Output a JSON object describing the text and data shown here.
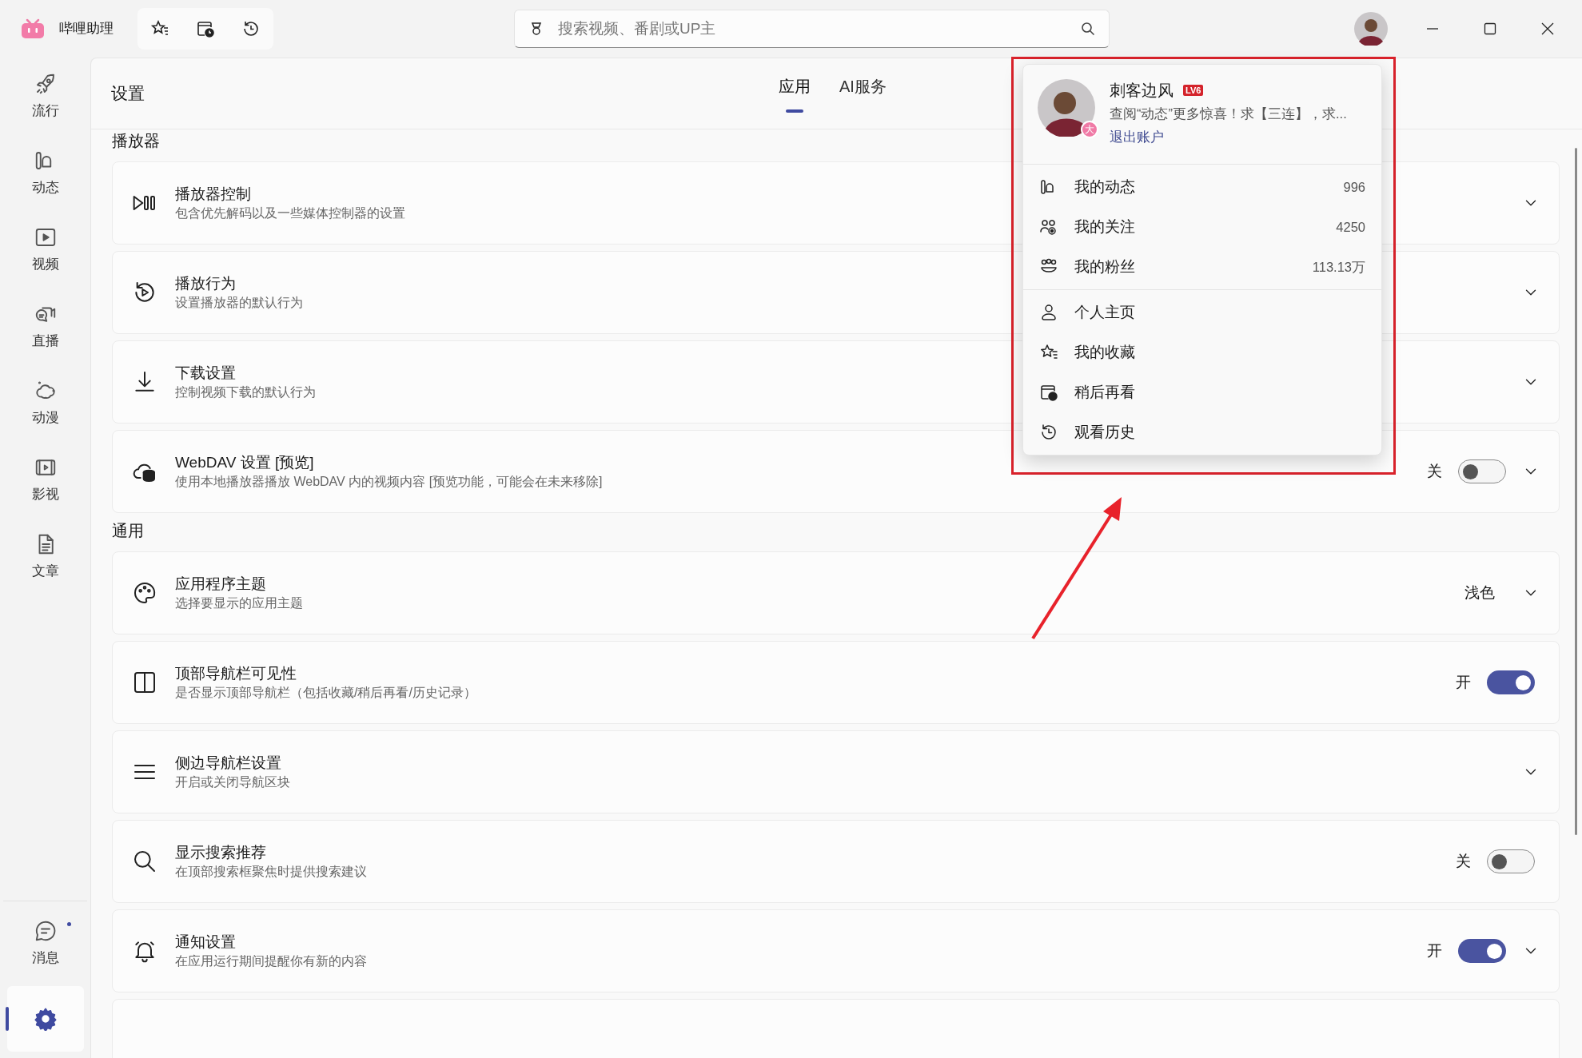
{
  "app": {
    "title": "哔哩助理"
  },
  "search": {
    "placeholder": "搜索视频、番剧或UP主"
  },
  "sidebar": {
    "items": [
      {
        "label": "流行",
        "selected": false
      },
      {
        "label": "动态",
        "selected": false
      },
      {
        "label": "视频",
        "selected": false
      },
      {
        "label": "直播",
        "selected": false
      },
      {
        "label": "动漫",
        "selected": false
      },
      {
        "label": "影视",
        "selected": false
      },
      {
        "label": "文章",
        "selected": false
      }
    ],
    "bottom_items": [
      {
        "label": "消息",
        "selected": false,
        "unread": true
      },
      {
        "selected": true
      }
    ]
  },
  "page": {
    "title": "设置",
    "tabs": [
      {
        "label": "应用",
        "selected": true
      },
      {
        "label": "AI服务",
        "selected": false
      }
    ]
  },
  "sections": [
    {
      "title": "播放器",
      "rows": [
        {
          "title": "播放器控制",
          "subtitle": "包含优先解码以及一些媒体控制器的设置",
          "expandable": true
        },
        {
          "title": "播放行为",
          "subtitle": "设置播放器的默认行为",
          "expandable": true
        },
        {
          "title": "下载设置",
          "subtitle": "控制视频下载的默认行为",
          "expandable": true
        },
        {
          "title": "WebDAV 设置 [预览]",
          "subtitle": "使用本地播放器播放 WebDAV 内的视频内容 [预览功能，可能会在未来移除]",
          "expandable": true,
          "toggle": {
            "label": "关",
            "on": false
          }
        }
      ]
    },
    {
      "title": "通用",
      "rows": [
        {
          "title": "应用程序主题",
          "subtitle": "选择要显示的应用主题",
          "expandable": true,
          "value": "浅色"
        },
        {
          "title": "顶部导航栏可见性",
          "subtitle": "是否显示顶部导航栏（包括收藏/稍后再看/历史记录）",
          "expandable": false,
          "toggle": {
            "label": "开",
            "on": true
          }
        },
        {
          "title": "侧边导航栏设置",
          "subtitle": "开启或关闭导航区块",
          "expandable": true
        },
        {
          "title": "显示搜索推荐",
          "subtitle": "在顶部搜索框聚焦时提供搜索建议",
          "expandable": false,
          "toggle": {
            "label": "关",
            "on": false
          }
        },
        {
          "title": "通知设置",
          "subtitle": "在应用运行期间提醒你有新的内容",
          "expandable": true,
          "toggle": {
            "label": "开",
            "on": true
          }
        }
      ]
    }
  ],
  "account_menu": {
    "name": "刺客边风",
    "level_badge": "LV6",
    "avatar_badge": "大",
    "sign": "查阅“动态”更多惊喜！求【三连】，求...",
    "logout": "退出账户",
    "stats": [
      {
        "label": "我的动态",
        "count": "996"
      },
      {
        "label": "我的关注",
        "count": "4250"
      },
      {
        "label": "我的粉丝",
        "count": "113.13万"
      }
    ],
    "links": [
      {
        "label": "个人主页"
      },
      {
        "label": "我的收藏"
      },
      {
        "label": "稍后再看"
      },
      {
        "label": "观看历史"
      }
    ]
  }
}
